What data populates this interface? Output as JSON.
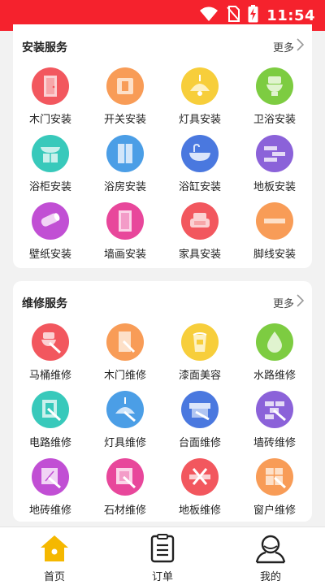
{
  "status_bar": {
    "time": "11:54",
    "icons": [
      "wifi-icon",
      "no-sim-icon",
      "battery-charging-icon"
    ]
  },
  "colors": {
    "brand": "#f5222d",
    "nav_active": "#f5b800"
  },
  "install_section": {
    "title": "安装服务",
    "more": "更多",
    "items": [
      {
        "label": "木门安装",
        "icon": "door-icon",
        "color": "#f2575e"
      },
      {
        "label": "开关安装",
        "icon": "switch-icon",
        "color": "#f89c57"
      },
      {
        "label": "灯具安装",
        "icon": "lamp-icon",
        "color": "#f7ce3b"
      },
      {
        "label": "卫浴安装",
        "icon": "toilet-icon",
        "color": "#7dcc41"
      },
      {
        "label": "浴柜安装",
        "icon": "bath-cabinet-icon",
        "color": "#38c9bb"
      },
      {
        "label": "浴房安装",
        "icon": "shower-room-icon",
        "color": "#4b9ee6"
      },
      {
        "label": "浴缸安装",
        "icon": "bathtub-icon",
        "color": "#4a78df"
      },
      {
        "label": "地板安装",
        "icon": "floor-icon",
        "color": "#8b62d9"
      },
      {
        "label": "壁纸安装",
        "icon": "wallpaper-icon",
        "color": "#c14fd4"
      },
      {
        "label": "墙画安装",
        "icon": "wall-painting-icon",
        "color": "#e8479b"
      },
      {
        "label": "家具安装",
        "icon": "sofa-icon",
        "color": "#f2575e"
      },
      {
        "label": "脚线安装",
        "icon": "baseboard-icon",
        "color": "#f89c57"
      }
    ]
  },
  "repair_section": {
    "title": "维修服务",
    "more": "更多",
    "items": [
      {
        "label": "马桶维修",
        "icon": "toilet-repair-icon",
        "color": "#f2575e"
      },
      {
        "label": "木门维修",
        "icon": "door-repair-icon",
        "color": "#f89c57"
      },
      {
        "label": "漆面美容",
        "icon": "paint-bucket-icon",
        "color": "#f7ce3b"
      },
      {
        "label": "水路维修",
        "icon": "water-drop-icon",
        "color": "#7dcc41"
      },
      {
        "label": "电路维修",
        "icon": "circuit-repair-icon",
        "color": "#38c9bb"
      },
      {
        "label": "灯具维修",
        "icon": "lamp-repair-icon",
        "color": "#4b9ee6"
      },
      {
        "label": "台面维修",
        "icon": "countertop-repair-icon",
        "color": "#4a78df"
      },
      {
        "label": "墙砖维修",
        "icon": "wall-tile-repair-icon",
        "color": "#8b62d9"
      },
      {
        "label": "地砖维修",
        "icon": "floor-tile-repair-icon",
        "color": "#c14fd4"
      },
      {
        "label": "石材维修",
        "icon": "stone-repair-icon",
        "color": "#e8479b"
      },
      {
        "label": "地板维修",
        "icon": "floor-repair-icon",
        "color": "#f2575e"
      },
      {
        "label": "窗户维修",
        "icon": "window-repair-icon",
        "color": "#f89c57"
      }
    ]
  },
  "bottom_nav": [
    {
      "label": "首页",
      "icon": "home-icon",
      "active": true
    },
    {
      "label": "订单",
      "icon": "orders-icon",
      "active": false
    },
    {
      "label": "我的",
      "icon": "profile-icon",
      "active": false
    }
  ]
}
